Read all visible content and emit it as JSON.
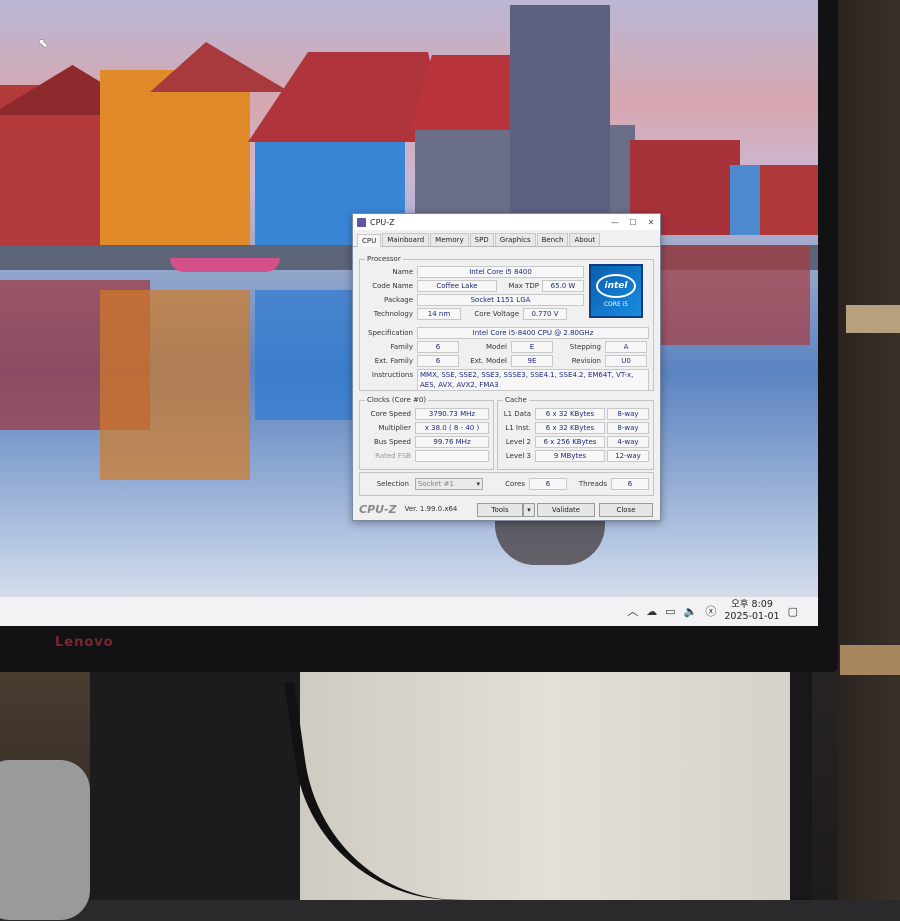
{
  "monitor": {
    "brand": "Lenovo"
  },
  "taskbar": {
    "time": "오후 8:09",
    "date": "2025-01-01",
    "tray_icons": [
      "chevron-up-icon",
      "onedrive-icon",
      "network-icon",
      "speaker-icon",
      "notification-icon"
    ]
  },
  "cpuz": {
    "title": "CPU-Z",
    "tabs": [
      "CPU",
      "Mainboard",
      "Memory",
      "SPD",
      "Graphics",
      "Bench",
      "About"
    ],
    "active_tab": "CPU",
    "processor": {
      "group_label": "Processor",
      "name_label": "Name",
      "name": "Intel Core i5 8400",
      "codename_label": "Code Name",
      "codename": "Coffee Lake",
      "maxtdp_label": "Max TDP",
      "maxtdp": "65.0 W",
      "package_label": "Package",
      "package": "Socket 1151 LGA",
      "technology_label": "Technology",
      "technology": "14 nm",
      "corevoltage_label": "Core Voltage",
      "corevoltage": "0.770 V",
      "spec_label": "Specification",
      "spec": "Intel Core i5-8400 CPU @ 2.80GHz",
      "family_label": "Family",
      "family": "6",
      "model_label": "Model",
      "model": "E",
      "stepping_label": "Stepping",
      "stepping": "A",
      "extfamily_label": "Ext. Family",
      "extfamily": "6",
      "extmodel_label": "Ext. Model",
      "extmodel": "9E",
      "revision_label": "Revision",
      "revision": "U0",
      "instructions_label": "Instructions",
      "instructions": "MMX, SSE, SSE2, SSE3, SSSE3, SSE4.1, SSE4.2, EM64T, VT-x, AES, AVX, AVX2, FMA3",
      "logo_text": "intel",
      "logo_badge": "CORE i5"
    },
    "clocks": {
      "group_label": "Clocks (Core #0)",
      "corespeed_label": "Core Speed",
      "corespeed": "3790.73 MHz",
      "multiplier_label": "Multiplier",
      "multiplier": "x 38.0 ( 8 - 40 )",
      "busspeed_label": "Bus Speed",
      "busspeed": "99.76 MHz",
      "ratedfsb_label": "Rated FSB",
      "ratedfsb": ""
    },
    "cache": {
      "group_label": "Cache",
      "l1data_label": "L1 Data",
      "l1data": "6 x 32 KBytes",
      "l1data_way": "8-way",
      "l1inst_label": "L1 Inst.",
      "l1inst": "6 x 32 KBytes",
      "l1inst_way": "8-way",
      "level2_label": "Level 2",
      "level2": "6 x 256 KBytes",
      "level2_way": "4-way",
      "level3_label": "Level 3",
      "level3": "9 MBytes",
      "level3_way": "12-way"
    },
    "selection": {
      "label": "Selection",
      "value": "Socket #1",
      "cores_label": "Cores",
      "cores": "6",
      "threads_label": "Threads",
      "threads": "6"
    },
    "footer": {
      "logo": "CPU-Z",
      "version": "Ver. 1.99.0.x64",
      "tools": "Tools",
      "validate": "Validate",
      "close": "Close"
    }
  }
}
